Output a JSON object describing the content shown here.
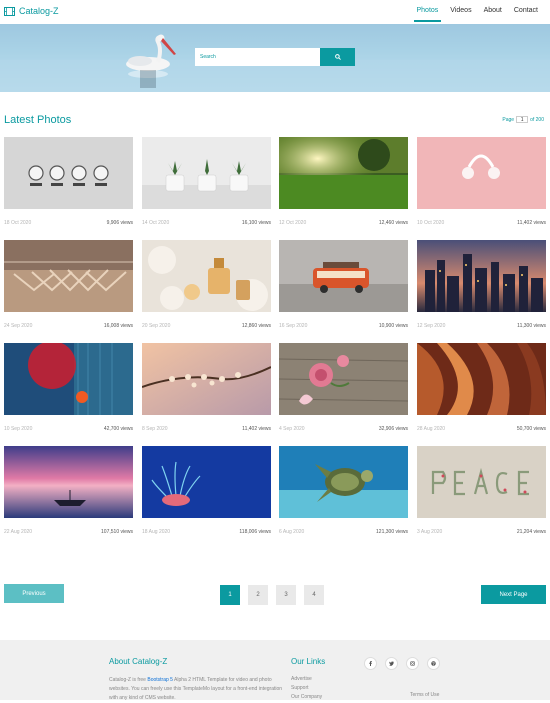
{
  "navbar": {
    "brand": "Catalog-Z",
    "items": [
      {
        "label": "Photos",
        "active": true
      },
      {
        "label": "Videos",
        "active": false
      },
      {
        "label": "About",
        "active": false
      },
      {
        "label": "Contact",
        "active": false
      }
    ]
  },
  "hero": {
    "search_placeholder": "Search",
    "search_icon": "search-icon"
  },
  "main": {
    "title": "Latest Photos",
    "page_label": "Page",
    "page_current": "1",
    "page_total": "of 200"
  },
  "photos": [
    {
      "date": "18 Oct 2020",
      "views": "9,906 views",
      "subject": "clocks"
    },
    {
      "date": "14 Oct 2020",
      "views": "16,100 views",
      "subject": "plants"
    },
    {
      "date": "12 Oct 2020",
      "views": "12,460 views",
      "subject": "grass"
    },
    {
      "date": "10 Oct 2020",
      "views": "11,402 views",
      "subject": "headphones"
    },
    {
      "date": "24 Sep 2020",
      "views": "16,008 views",
      "subject": "hangers"
    },
    {
      "date": "20 Sep 2020",
      "views": "12,860 views",
      "subject": "perfume"
    },
    {
      "date": "16 Sep 2020",
      "views": "10,900 views",
      "subject": "bus"
    },
    {
      "date": "12 Sep 2020",
      "views": "11,300 views",
      "subject": "city"
    },
    {
      "date": "10 Sep 2020",
      "views": "42,700 views",
      "subject": "red-light"
    },
    {
      "date": "8 Sep 2020",
      "views": "11,402 views",
      "subject": "blossom"
    },
    {
      "date": "4 Sep 2020",
      "views": "32,906 views",
      "subject": "roses"
    },
    {
      "date": "28 Aug 2020",
      "views": "50,700 views",
      "subject": "canyon"
    },
    {
      "date": "22 Aug 2020",
      "views": "107,510 views",
      "subject": "boat"
    },
    {
      "date": "18 Aug 2020",
      "views": "118,006 views",
      "subject": "anemone"
    },
    {
      "date": "6 Aug 2020",
      "views": "121,300 views",
      "subject": "turtle"
    },
    {
      "date": "3 Aug 2020",
      "views": "21,204 views",
      "subject": "peace"
    }
  ],
  "pagination": {
    "previous": "Previous",
    "next": "Next Page",
    "pages": [
      "1",
      "2",
      "3",
      "4"
    ],
    "active": "1"
  },
  "footer": {
    "about_title": "About Catalog-Z",
    "about_text_1": "Catalog-Z is free ",
    "about_link": "Bootstrap 5",
    "about_text_2": " Alpha 2 HTML Template for video and photo websites. You can freely use this TemplateMo layout for a front-end integration with any kind of CMS website.",
    "links_title": "Our Links",
    "links": [
      "Advertise",
      "Support",
      "Our Company"
    ],
    "socials": [
      "facebook-icon",
      "twitter-icon",
      "instagram-icon",
      "pinterest-icon"
    ],
    "terms": "Terms of Use"
  },
  "colors": {
    "accent": "#0b9aa0",
    "prev_button": "#5cbfc4",
    "footer_bg": "#f0f0f0"
  }
}
